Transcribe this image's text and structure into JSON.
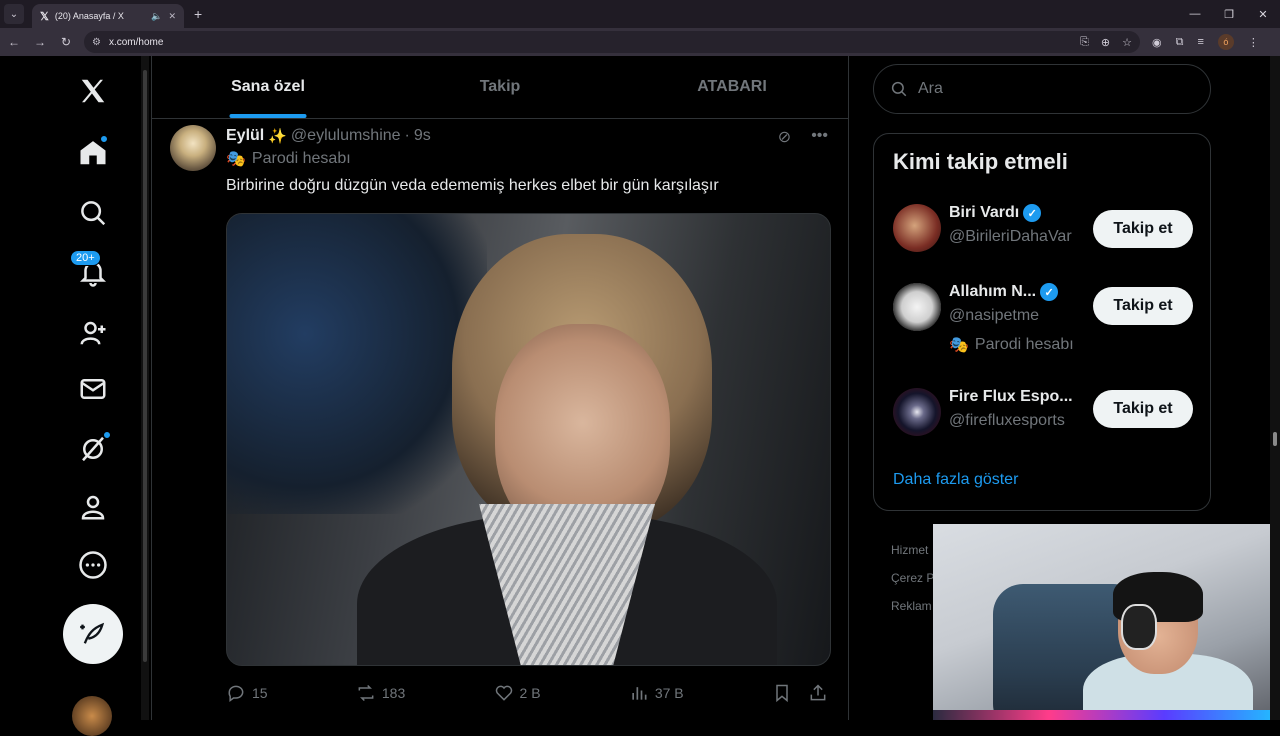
{
  "browser": {
    "tab_title": "(20) Anasayfa / X",
    "url": "x.com/home",
    "profile_initial": "ó"
  },
  "nav": {
    "notifications_badge": "20+"
  },
  "feed_tabs": [
    "Sana özel",
    "Takip",
    "ATABARI"
  ],
  "tweet": {
    "name": "Eylül",
    "emoji": "✨",
    "handle": "@eylulumshine",
    "separator": "·",
    "time": "9s",
    "parody_label": "Parodi hesabı",
    "text": "Birbirine doğru düzgün veda edememiş herkes elbet bir gün karşılaşır",
    "replies": "15",
    "reposts": "183",
    "likes": "2 B",
    "views": "37 B"
  },
  "search": {
    "placeholder": "Ara"
  },
  "who_to_follow": {
    "title": "Kimi takip etmeli",
    "items": [
      {
        "name": "Biri Vardı",
        "handle": "@BirileriDahaVar",
        "verified": true,
        "parody": "",
        "button": "Takip et"
      },
      {
        "name": "Allahım N...",
        "handle": "@nasipetme",
        "verified": true,
        "parody": "Parodi hesabı",
        "button": "Takip et"
      },
      {
        "name": "Fire Flux Espo...",
        "handle": "@firefluxesports",
        "verified": false,
        "parody": "",
        "button": "Takip et"
      }
    ],
    "show_more": "Daha fazla göster"
  },
  "footer": {
    "links": [
      "Hizmet",
      "Çerez P",
      "Reklam"
    ]
  },
  "colors": {
    "accent": "#1d9bf0",
    "background": "#000000",
    "border": "#2f3336",
    "muted": "#71767b"
  }
}
